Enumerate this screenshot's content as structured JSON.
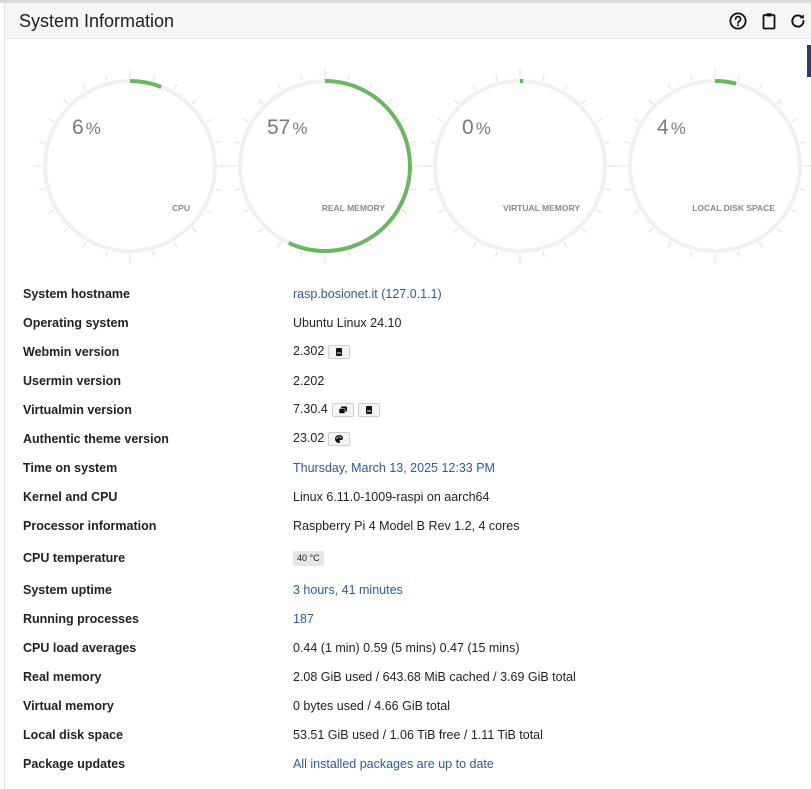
{
  "panel": {
    "title": "System Information",
    "icons": {
      "help": "help-circle-icon",
      "clipboard": "clipboard-icon",
      "refresh": "refresh-icon"
    }
  },
  "gauges": [
    {
      "value": 6,
      "unit": "%",
      "label": "CPU"
    },
    {
      "value": 57,
      "unit": "%",
      "label": "REAL MEMORY"
    },
    {
      "value": 0,
      "unit": "%",
      "label": "VIRTUAL MEMORY"
    },
    {
      "value": 4,
      "unit": "%",
      "label": "LOCAL DISK SPACE"
    }
  ],
  "colors": {
    "gauge_fill": "#6ab761",
    "gauge_track": "#f1f1f1",
    "link": "#2e5a9c"
  },
  "info": [
    {
      "key": "System hostname",
      "value": "rasp.bosionet.it (127.0.1.1)",
      "link": true
    },
    {
      "key": "Operating system",
      "value": "Ubuntu Linux 24.10"
    },
    {
      "key": "Webmin version",
      "value": "2.302",
      "badges": [
        "book-icon"
      ]
    },
    {
      "key": "Usermin version",
      "value": "2.202"
    },
    {
      "key": "Virtualmin version",
      "value": "7.30.4",
      "badges": [
        "docs-icon",
        "book-icon"
      ]
    },
    {
      "key": "Authentic theme version",
      "value": "23.02",
      "badges": [
        "palette-icon"
      ]
    },
    {
      "key": "Time on system",
      "value": "Thursday, March 13, 2025 12:33 PM",
      "link": true
    },
    {
      "key": "Kernel and CPU",
      "value": "Linux 6.11.0-1009-raspi on aarch64"
    },
    {
      "key": "Processor information",
      "value": "Raspberry Pi 4 Model B Rev 1.2, 4 cores"
    },
    {
      "key": "CPU temperature",
      "value": "40 °C",
      "temp": true
    },
    {
      "key": "System uptime",
      "value": "3 hours, 41 minutes",
      "link": true
    },
    {
      "key": "Running processes",
      "value": "187",
      "link": true
    },
    {
      "key": "CPU load averages",
      "value": "0.44 (1 min) 0.59 (5 mins) 0.47 (15 mins)"
    },
    {
      "key": "Real memory",
      "value": "2.08 GiB used / 643.68 MiB cached / 3.69 GiB total"
    },
    {
      "key": "Virtual memory",
      "value": "0 bytes used / 4.66 GiB total"
    },
    {
      "key": "Local disk space",
      "value": "53.51 GiB used / 1.06 TiB free / 1.11 TiB total"
    },
    {
      "key": "Package updates",
      "value": "All installed packages are up to date",
      "link": true
    }
  ]
}
